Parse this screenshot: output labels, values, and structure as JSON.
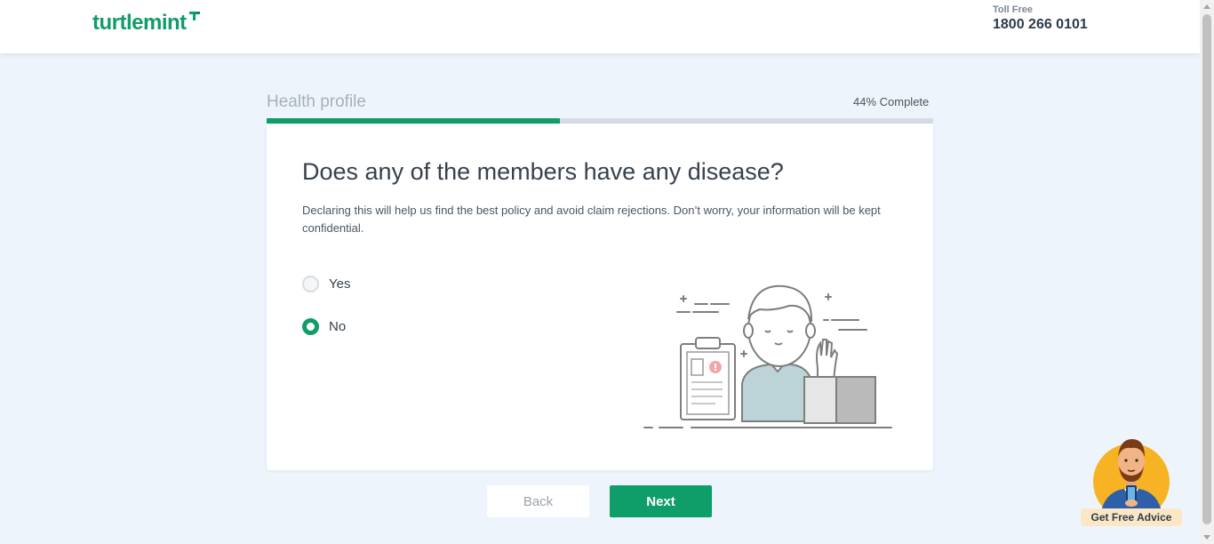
{
  "header": {
    "logo_text": "turtlemint",
    "toll_free_label": "Toll Free",
    "toll_free_number": "1800 266 0101"
  },
  "progress": {
    "section_title": "Health profile",
    "complete_text": "44% Complete",
    "percent": 44
  },
  "question": {
    "title": "Does any of the members have any disease?",
    "description": "Declaring this will help us find the best policy and avoid claim rejections. Don’t worry, your information will be kept confidential.",
    "options": [
      {
        "label": "Yes",
        "selected": false
      },
      {
        "label": "No",
        "selected": true
      }
    ]
  },
  "buttons": {
    "back_label": "Back",
    "next_label": "Next"
  },
  "advisor": {
    "label": "Get Free Advice"
  },
  "colors": {
    "brand_green": "#0f9d69",
    "background": "#eef4fb",
    "advisor_badge": "#fbe7c6"
  }
}
